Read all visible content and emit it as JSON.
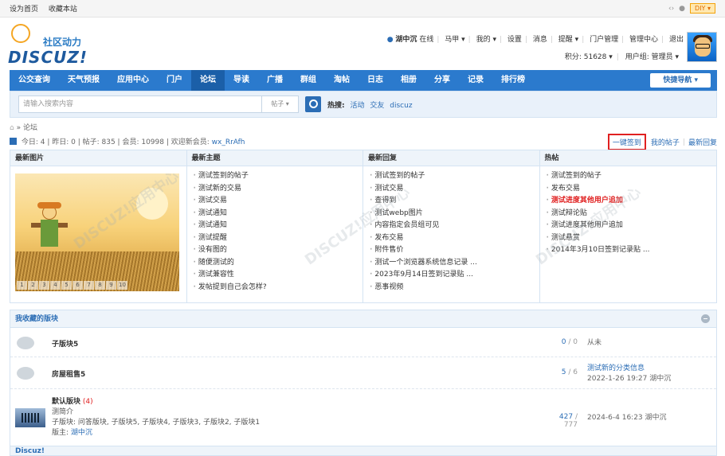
{
  "topbar": {
    "set_home": "设为首页",
    "bookmark": "收藏本站",
    "diy": "DIY"
  },
  "logo": {
    "cn": "社区动力",
    "en": "DISCUZ!"
  },
  "user": {
    "name": "湖中沉",
    "status": "在线",
    "links": [
      "马甲",
      "我的",
      "设置",
      "消息",
      "提醒",
      "门户管理",
      "管理中心",
      "退出"
    ],
    "points": "积分: 51628",
    "group": "用户组: 管理员"
  },
  "nav": {
    "items": [
      "公交查询",
      "天气预报",
      "应用中心",
      "门户",
      "论坛",
      "导读",
      "广播",
      "群组",
      "淘帖",
      "日志",
      "相册",
      "分享",
      "记录",
      "排行榜"
    ],
    "active": "论坛",
    "quick": "快捷导航"
  },
  "search": {
    "placeholder": "请输入搜索内容",
    "type": "帖子",
    "hot_label": "热搜:",
    "hot": [
      "活动",
      "交友",
      "discuz"
    ]
  },
  "breadcrumb": "论坛",
  "stats": {
    "text": "今日: 4 | 昨日: 0 | 帖子: 835 | 会员: 10998 | 欢迎新会员:",
    "newuser": "wx_RrAfh"
  },
  "toplinks": {
    "checkin": "一键签到",
    "myposts": "我的帖子",
    "latest": "最新回复"
  },
  "grid": {
    "pictures": {
      "title": "最新图片",
      "pages": [
        "1",
        "2",
        "3",
        "4",
        "5",
        "6",
        "7",
        "8",
        "9",
        "10"
      ]
    },
    "newtopics": {
      "title": "最新主题",
      "items": [
        "测试签到的帖子",
        "测试新的交易",
        "测试交易",
        "测试通知",
        "测试通知",
        "测试提醒",
        "没有图的",
        "随便测试的",
        "测试兼容性",
        "发帖提到自己会怎样?"
      ]
    },
    "newreply": {
      "title": "最新回复",
      "items": [
        "测试签到的帖子",
        "测试交易",
        "查得到",
        "测试webp图片",
        "内容指定会员组可见",
        "发布交易",
        "附件售价",
        "测试一个浏览器系统信息记录 ...",
        "2023年9月14日签到记录贴 ...",
        "恶事视频"
      ]
    },
    "hot": {
      "title": "热帖",
      "items": [
        "测试签到的帖子",
        "发布交易",
        "测试进度其他用户追加",
        "测试辩论贴",
        "测试进度其他用户追加",
        "测试悬赏",
        "2014年3月10日签到记录贴 ..."
      ],
      "red_index": 2
    }
  },
  "fav": {
    "title": "我收藏的版块",
    "rows": [
      {
        "name": "子版块5",
        "count_a": "0",
        "count_b": "0",
        "last": "从未"
      },
      {
        "name": "房屋租售5",
        "count_a": "5",
        "count_b": "6",
        "last_title": "测试新的分类信息",
        "last": "2022-1-26 19:27 湖中沉"
      },
      {
        "name": "默认版块",
        "new": "(4)",
        "desc": "测简介",
        "subs": "子版块: 问答版块, 子版块5, 子版块4, 子版块3, 子版块2, 子版块1",
        "mod_label": "版主:",
        "mod": "湖中沉",
        "count_a": "427",
        "count_b": "777",
        "last": "2024-6-4 16:23 湖中沉"
      }
    ],
    "footer": "Discuz!"
  },
  "colors": {
    "nav": "#2b7acd",
    "link": "#2b6db5",
    "highlight": "#e02020"
  }
}
